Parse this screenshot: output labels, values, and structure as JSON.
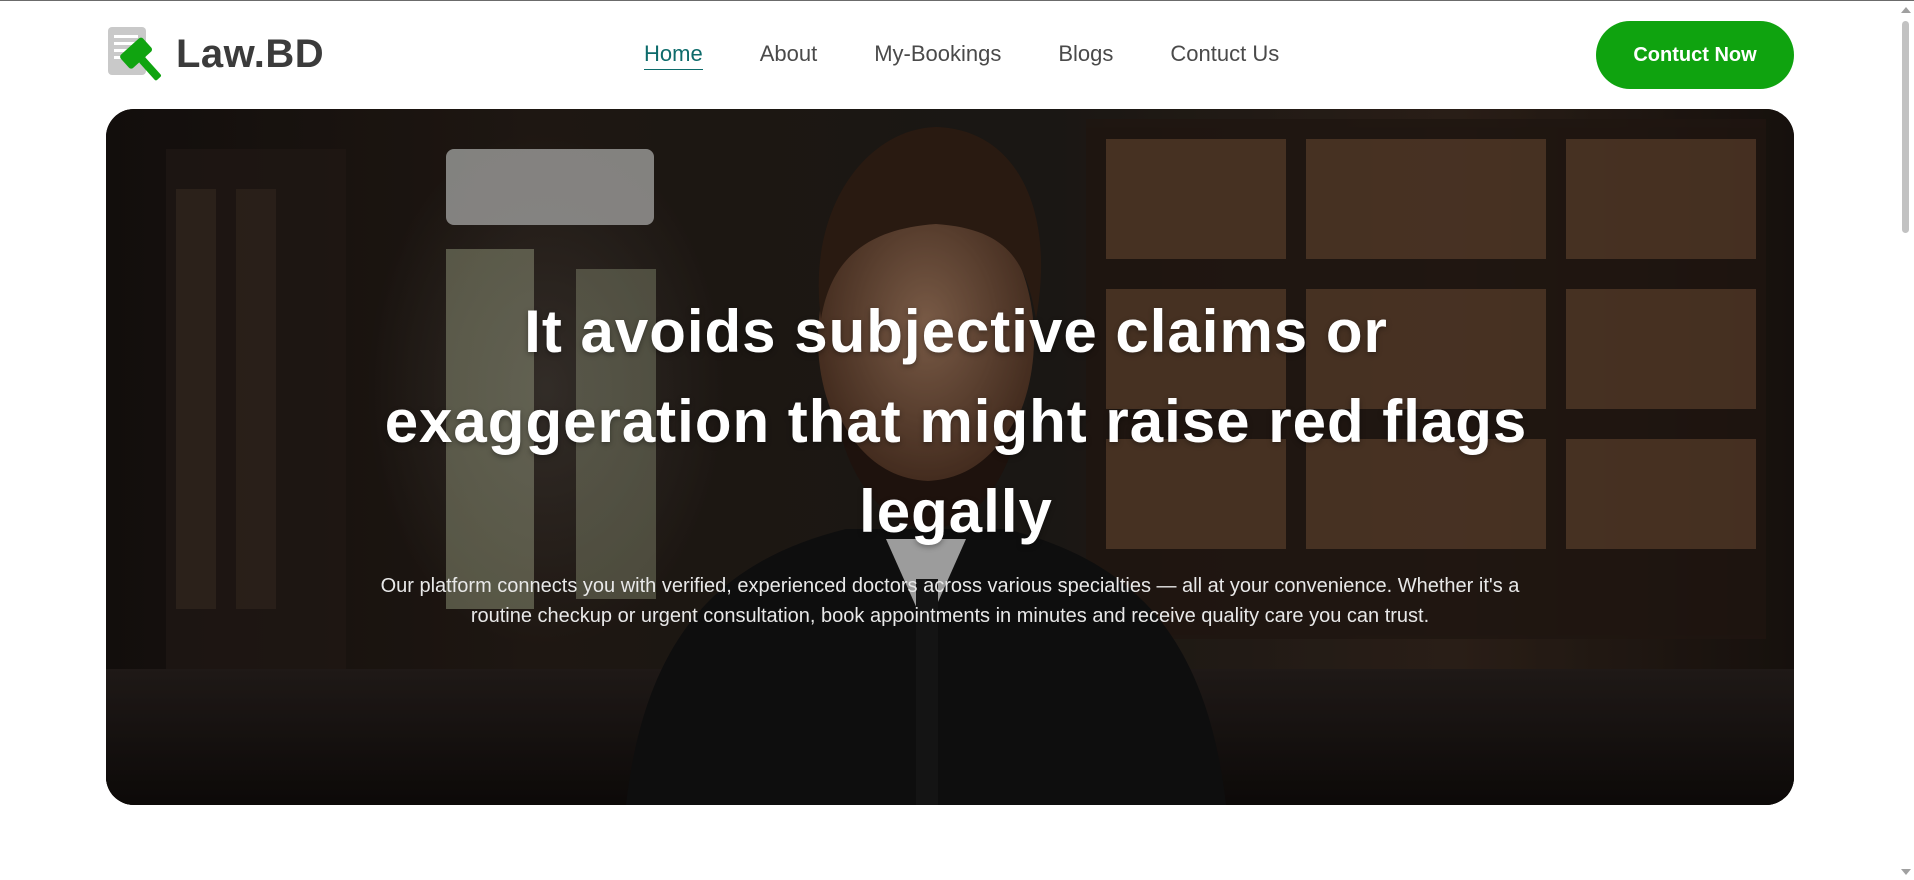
{
  "header": {
    "logo_text": "Law.BD",
    "nav": [
      {
        "label": "Home",
        "active": true
      },
      {
        "label": "About",
        "active": false
      },
      {
        "label": "My-Bookings",
        "active": false
      },
      {
        "label": "Blogs",
        "active": false
      },
      {
        "label": "Contuct Us",
        "active": false
      }
    ],
    "cta_label": "Contuct Now"
  },
  "hero": {
    "title": "It avoids subjective claims or exaggeration that might raise red flags legally",
    "subtitle": "Our platform connects you with verified, experienced doctors across various specialties — all at your convenience. Whether it's a routine checkup or urgent consultation, book appointments in minutes and receive quality care you can trust."
  },
  "icons": {
    "logo": "gavel-document-icon",
    "scroll_up": "scroll-up-arrow-icon",
    "scroll_down": "scroll-down-arrow-icon"
  },
  "colors": {
    "accent_green": "#0fa30f",
    "nav_active": "#0d6b6b",
    "logo_text": "#3b3b3b",
    "nav_text": "#4a4a4a"
  }
}
